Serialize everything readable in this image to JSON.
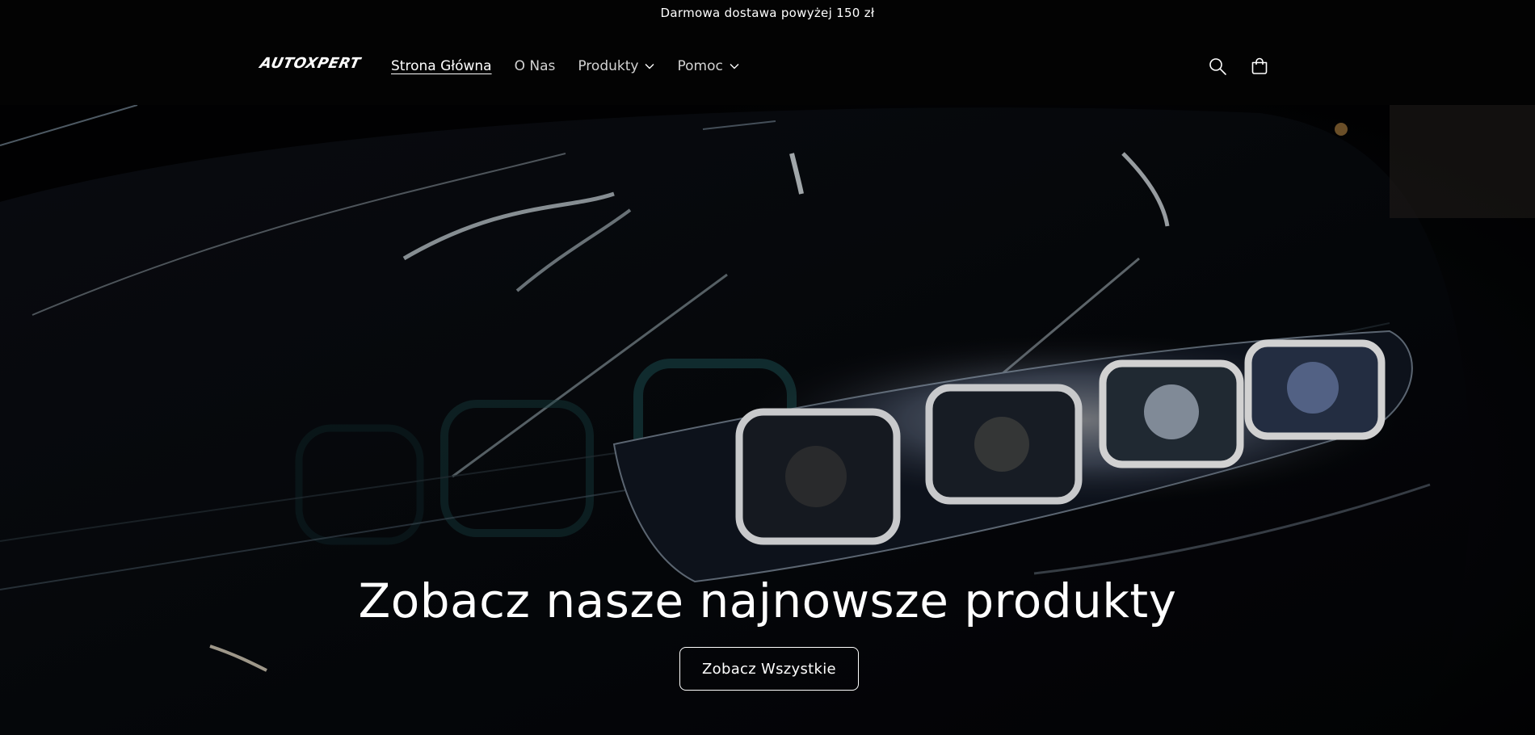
{
  "announcement": {
    "text": "Darmowa dostawa powyżej 150 zł"
  },
  "header": {
    "logo_text": "AUTOXPERT",
    "nav": [
      {
        "label": "Strona Główna",
        "active": true,
        "has_dropdown": false
      },
      {
        "label": "O Nas",
        "active": false,
        "has_dropdown": false
      },
      {
        "label": "Produkty",
        "active": false,
        "has_dropdown": true
      },
      {
        "label": "Pomoc",
        "active": false,
        "has_dropdown": true
      }
    ],
    "icons": [
      "search-icon",
      "cart-icon"
    ]
  },
  "hero": {
    "title": "Zobacz nasze najnowsze produkty",
    "button_label": "Zobacz Wszystkie"
  },
  "colors": {
    "background": "#030303",
    "text": "#ffffff"
  }
}
